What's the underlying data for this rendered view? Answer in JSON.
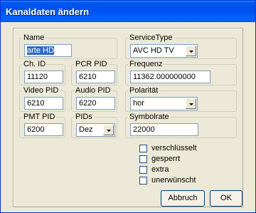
{
  "window": {
    "title": "Kanaldaten ändern"
  },
  "fields": {
    "name": {
      "label": "Name",
      "value": "arte HD"
    },
    "service_type": {
      "label": "ServiceType",
      "value": "AVC HD TV"
    },
    "ch_id": {
      "label": "Ch. ID",
      "value": "11120"
    },
    "pcr_pid": {
      "label": "PCR PID",
      "value": "6210"
    },
    "frequenz": {
      "label": "Frequenz",
      "value": "11362.000000000"
    },
    "video_pid": {
      "label": "Video PID",
      "value": "6210"
    },
    "audio_pid": {
      "label": "Audio PID",
      "value": "6220"
    },
    "polaritaet": {
      "label": "Polarität",
      "value": "hor"
    },
    "pmt_pid": {
      "label": "PMT PID",
      "value": "6200"
    },
    "pids": {
      "label": "PIDs",
      "value": "Dez"
    },
    "symbolrate": {
      "label": "Symbolrate",
      "value": "22000"
    }
  },
  "checkboxes": [
    {
      "label": "verschlüsselt",
      "checked": false
    },
    {
      "label": "gesperrt",
      "checked": false
    },
    {
      "label": "extra",
      "checked": false
    },
    {
      "label": "unerwünscht",
      "checked": false
    }
  ],
  "buttons": {
    "cancel": "Abbruch",
    "ok": "OK"
  }
}
